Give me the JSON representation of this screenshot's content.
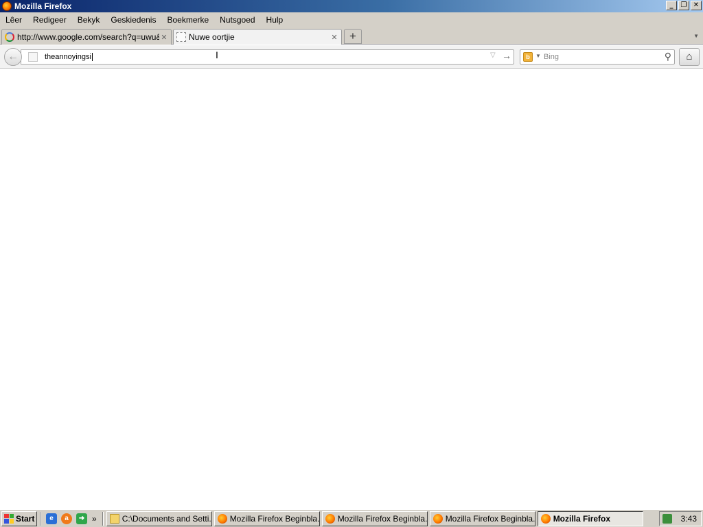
{
  "window": {
    "title": "Mozilla Firefox",
    "controls": {
      "minimize": "_",
      "restore": "❐",
      "close": "✕"
    }
  },
  "menu": [
    "Lêer",
    "Redigeer",
    "Bekyk",
    "Geskiedenis",
    "Boekmerke",
    "Nutsgoed",
    "Hulp"
  ],
  "tabs": [
    {
      "label": "http://www.google.com/search?q=uwu&...",
      "icon": "google-icon",
      "active": false,
      "close": "✕"
    },
    {
      "label": "Nuwe oortjie",
      "icon": "blank-page-icon",
      "active": true,
      "close": "✕"
    }
  ],
  "newtab_symbol": "+",
  "navbar": {
    "back_symbol": "🡐",
    "url_value": "theannoyingsi",
    "go_symbol": "→",
    "dropmarker_symbol": "▽",
    "search_engine_label": "Bing",
    "search_go_symbol": "⚲",
    "home_symbol": "⌂"
  },
  "taskbar": {
    "start_label": "Start",
    "more_symbol": "»",
    "tasks": [
      {
        "label": "C:\\Documents and Setti...",
        "icon": "folder-icon",
        "active": false
      },
      {
        "label": "Mozilla Firefox Beginbla...",
        "icon": "firefox-icon",
        "active": false
      },
      {
        "label": "Mozilla Firefox Beginbla...",
        "icon": "firefox-icon",
        "active": false
      },
      {
        "label": "Mozilla Firefox Beginbla...",
        "icon": "firefox-icon",
        "active": false
      },
      {
        "label": "Mozilla Firefox",
        "icon": "firefox-icon",
        "active": true
      }
    ],
    "clock": "3:43"
  }
}
